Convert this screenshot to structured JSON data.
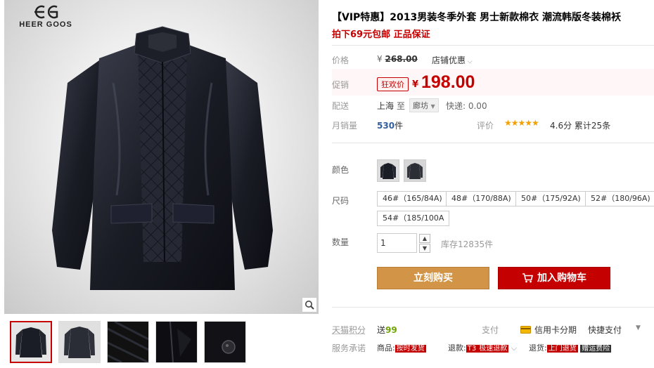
{
  "brand": {
    "name": "HEER GOOS"
  },
  "product": {
    "title": "【VIP特惠】2013男装冬季外套 男士新款棉衣 潮流韩版冬装棉袄",
    "subtitle": "拍下69元包邮 正品保证"
  },
  "price": {
    "label": "价格",
    "currency": "¥",
    "original": "268.00",
    "store_promo": "店铺优惠",
    "promo_label": "促销",
    "promo_badge": "狂欢价",
    "promo_price": "198.00"
  },
  "shipping": {
    "label": "配送",
    "from": "上海",
    "to_word": "至",
    "destination": "廊坊",
    "fee": "快递: 0.00"
  },
  "sales": {
    "label": "月销量",
    "count": "530",
    "unit": "件",
    "rating_label": "评价",
    "stars": "★★★★★",
    "score": "4.6分",
    "total": "累计25条"
  },
  "options": {
    "color_label": "颜色",
    "size_label": "尺码",
    "sizes": [
      "46#（165/84A)",
      "48#（170/88A)",
      "50#（175/92A)",
      "52#（180/96A)",
      "54#（185/100A"
    ],
    "quantity_label": "数量",
    "quantity_value": "1",
    "stock": "库存12835件"
  },
  "actions": {
    "buy_now": "立刻购买",
    "add_cart": "加入购物车"
  },
  "extras": {
    "points_label": "天猫积分",
    "points_prefix": "送",
    "points_value": "99",
    "pay_label": "支付",
    "pay_card": "信用卡分期",
    "pay_fast": "快捷支付",
    "service_label": "服务承诺",
    "svc_goods": "商品:",
    "svc_goods_tag": "按时发货",
    "svc_refund": "退款:",
    "svc_refund_tag1": "T3",
    "svc_refund_tag2": "极速退款",
    "svc_return": "退货:",
    "svc_return_tag1": "上门退货",
    "svc_return_tag2": "赠运费险"
  },
  "colors": {
    "accent": "#c40000",
    "buy": "#d29446",
    "link": "#2f5fa0",
    "green": "#6ea500"
  }
}
